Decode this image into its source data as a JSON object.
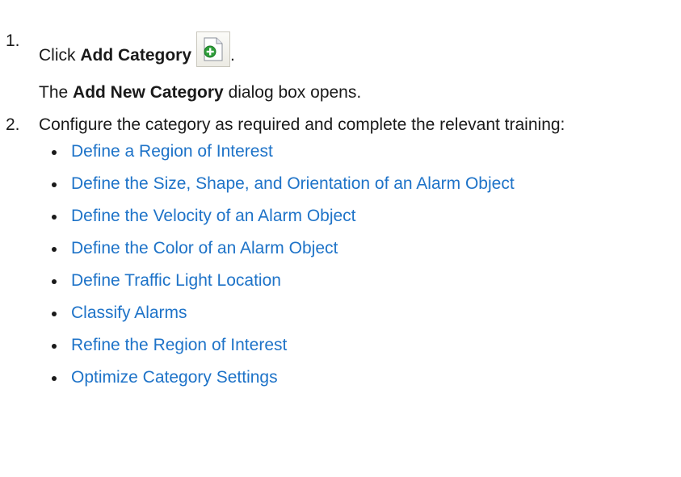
{
  "step1": {
    "number": "1.",
    "prefix": "Click ",
    "bold_label": "Add Category",
    "suffix": ".",
    "icon": "add-category-icon"
  },
  "step1_result": {
    "prefix": "The ",
    "bold_label": "Add New Category",
    "suffix": " dialog box opens."
  },
  "step2": {
    "number": "2.",
    "text": "Configure the category as required and complete the relevant training:"
  },
  "links": [
    "Define a Region of Interest",
    "Define the Size, Shape, and Orientation of an Alarm Object",
    "Define the Velocity of an Alarm Object",
    "Define the Color of an Alarm Object",
    "Define Traffic Light Location",
    "Classify Alarms",
    "Refine the Region of Interest",
    "Optimize Category Settings"
  ],
  "colors": {
    "link": "#1e73c8",
    "text": "#1a1a1a"
  }
}
